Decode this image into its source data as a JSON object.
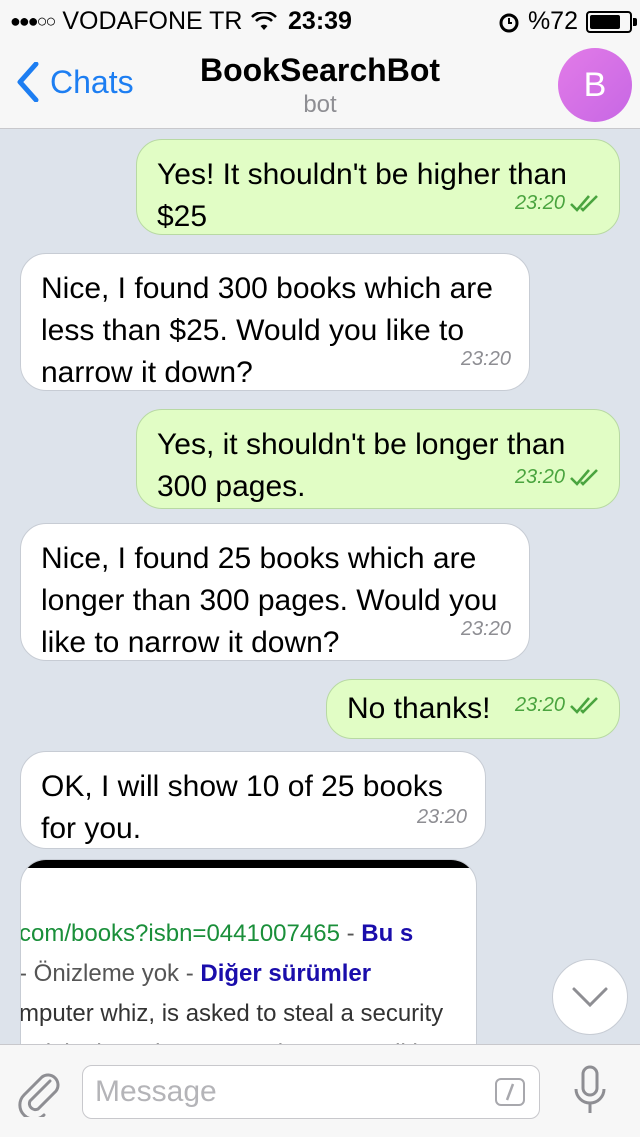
{
  "status": {
    "carrier": "VODAFONE TR",
    "time": "23:39",
    "battery_text": "%72",
    "battery_level": 0.72
  },
  "nav": {
    "back_label": "Chats",
    "title": "BookSearchBot",
    "subtitle": "bot",
    "avatar_letter": "B"
  },
  "messages": [
    {
      "dir": "out",
      "text": "Yes! It shouldn't be higher than $25",
      "time": "23:20"
    },
    {
      "dir": "in",
      "text": "Nice, I found 300 books which are less than $25. Would you like to narrow it down?",
      "time": "23:20"
    },
    {
      "dir": "out",
      "text": "Yes, it shouldn't be longer than 300 pages.",
      "time": "23:20"
    },
    {
      "dir": "in",
      "text": "Nice, I found 25 books which are longer than 300 pages. Would you like to narrow it down?",
      "time": "23:20"
    },
    {
      "dir": "out",
      "text": "No thanks!",
      "time": "23:20"
    },
    {
      "dir": "in",
      "text": "OK, I will show 10 of 25 books for you.",
      "time": "23:20"
    }
  ],
  "image_preview": {
    "line1_url": "com/books?isbn=0441007465",
    "line1_sep": " - ",
    "line1_tail": "Bu s",
    "line2_left": "- Önizleme yok - ",
    "line2_link": "Diğer sürümler",
    "line3": "mputer whiz, is asked to steal a security",
    "line4": "ank in the solar system, in a new edition"
  },
  "composer": {
    "placeholder": "Message"
  },
  "icons": {
    "back": "chevron-left-icon",
    "attach": "paperclip-icon",
    "command": "slash-command-icon",
    "mic": "microphone-icon",
    "scroll": "chevron-down-icon",
    "read": "double-check-icon"
  }
}
